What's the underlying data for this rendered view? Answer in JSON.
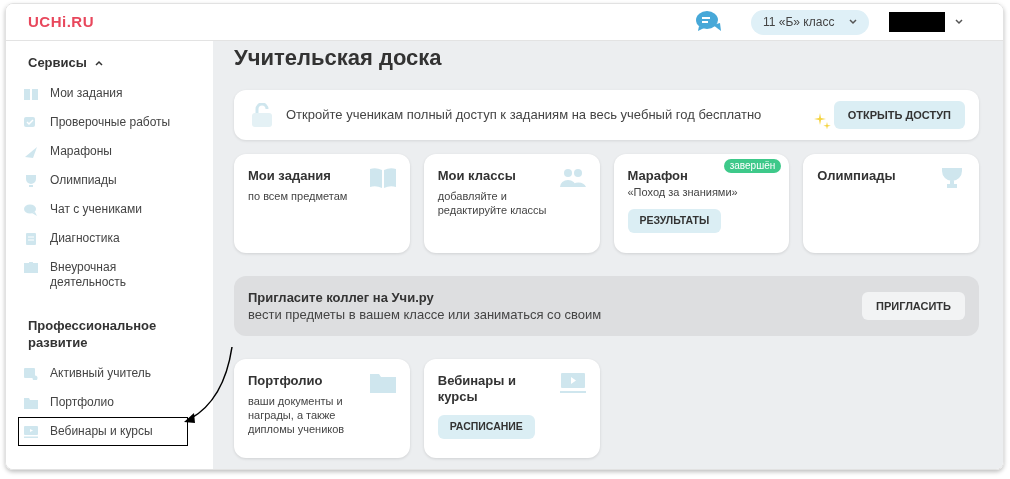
{
  "header": {
    "logo": "UCHi.RU",
    "class_selector": "11 «Б» класс"
  },
  "sidebar": {
    "sections": [
      {
        "title": "Сервисы",
        "expanded": true,
        "items": [
          {
            "label": "Мои задания",
            "highlighted": false
          },
          {
            "label": "Проверочные работы",
            "highlighted": false
          },
          {
            "label": "Марафоны",
            "highlighted": false
          },
          {
            "label": "Олимпиады",
            "highlighted": false
          },
          {
            "label": "Чат с учениками",
            "highlighted": false
          },
          {
            "label": "Диагностика",
            "highlighted": false
          },
          {
            "label": "Внеурочная деятельность",
            "highlighted": false
          }
        ]
      },
      {
        "title": "Профессиональное развитие",
        "items": [
          {
            "label": "Активный учитель",
            "highlighted": false
          },
          {
            "label": "Портфолио",
            "highlighted": false
          },
          {
            "label": "Вебинары и курсы",
            "highlighted": true
          }
        ]
      }
    ]
  },
  "main": {
    "title": "Учительская доска",
    "promo": {
      "text": "Откройте ученикам полный доступ к заданиям на весь учебный год бесплатно",
      "button": "ОТКРЫТЬ ДОСТУП"
    },
    "cards": [
      {
        "title": "Мои задания",
        "subtitle": "по всем предметам"
      },
      {
        "title": "Мои классы",
        "subtitle": "добавляйте и редактируйте классы"
      },
      {
        "title": "Марафон",
        "subtitle": "«Поход за знаниями»",
        "badge": "завершён",
        "button": "РЕЗУЛЬТАТЫ"
      },
      {
        "title": "Олимпиады"
      }
    ],
    "invite": {
      "title": "Пригласите коллег на Учи.ру",
      "text": "вести предметы в вашем классе или заниматься со своим",
      "button": "ПРИГЛАСИТЬ"
    },
    "cards_bottom": [
      {
        "title": "Портфолио",
        "subtitle": "ваши документы и награды, а также дипломы учеников"
      },
      {
        "title": "Вебинары и курсы",
        "button": "РАСПИСАНИЕ"
      }
    ]
  }
}
